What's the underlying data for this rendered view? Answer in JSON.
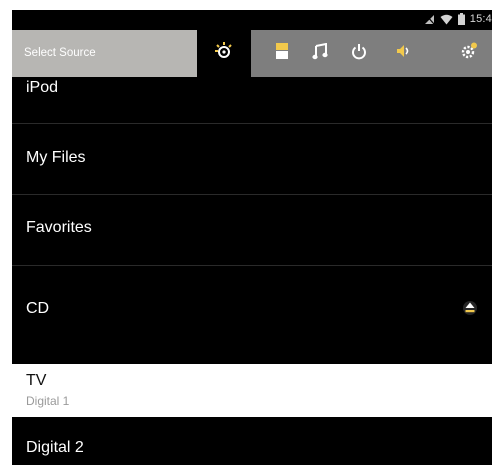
{
  "status_bar": {
    "time": "15:4",
    "icons": [
      "signal-off-icon",
      "wifi-icon",
      "battery-icon"
    ]
  },
  "toolbar": {
    "title": "Select Source",
    "tabs": [
      {
        "icon": "source-icon",
        "active": true
      },
      {
        "icon": "display-icon",
        "active": false
      },
      {
        "icon": "music-note-icon",
        "active": false
      },
      {
        "icon": "power-icon",
        "active": false
      },
      {
        "icon": "speaker-icon",
        "active": false
      },
      {
        "icon": "settings-icon",
        "active": false
      }
    ],
    "colors": {
      "title_bg": "#b7b6b3",
      "toolbar_bg": "#7e7e7e",
      "icon_accent": "#f2c94c"
    }
  },
  "sources": [
    {
      "label": "iPod",
      "sublabel": null,
      "selected": false
    },
    {
      "label": "My Files",
      "sublabel": null,
      "selected": false
    },
    {
      "label": "Favorites",
      "sublabel": null,
      "selected": false
    },
    {
      "label": "CD",
      "sublabel": null,
      "selected": false,
      "action_icon": "eject-icon"
    },
    {
      "label": "TV",
      "sublabel": "Digital 1",
      "selected": true
    },
    {
      "label": "Digital 2",
      "sublabel": null,
      "selected": false
    }
  ]
}
